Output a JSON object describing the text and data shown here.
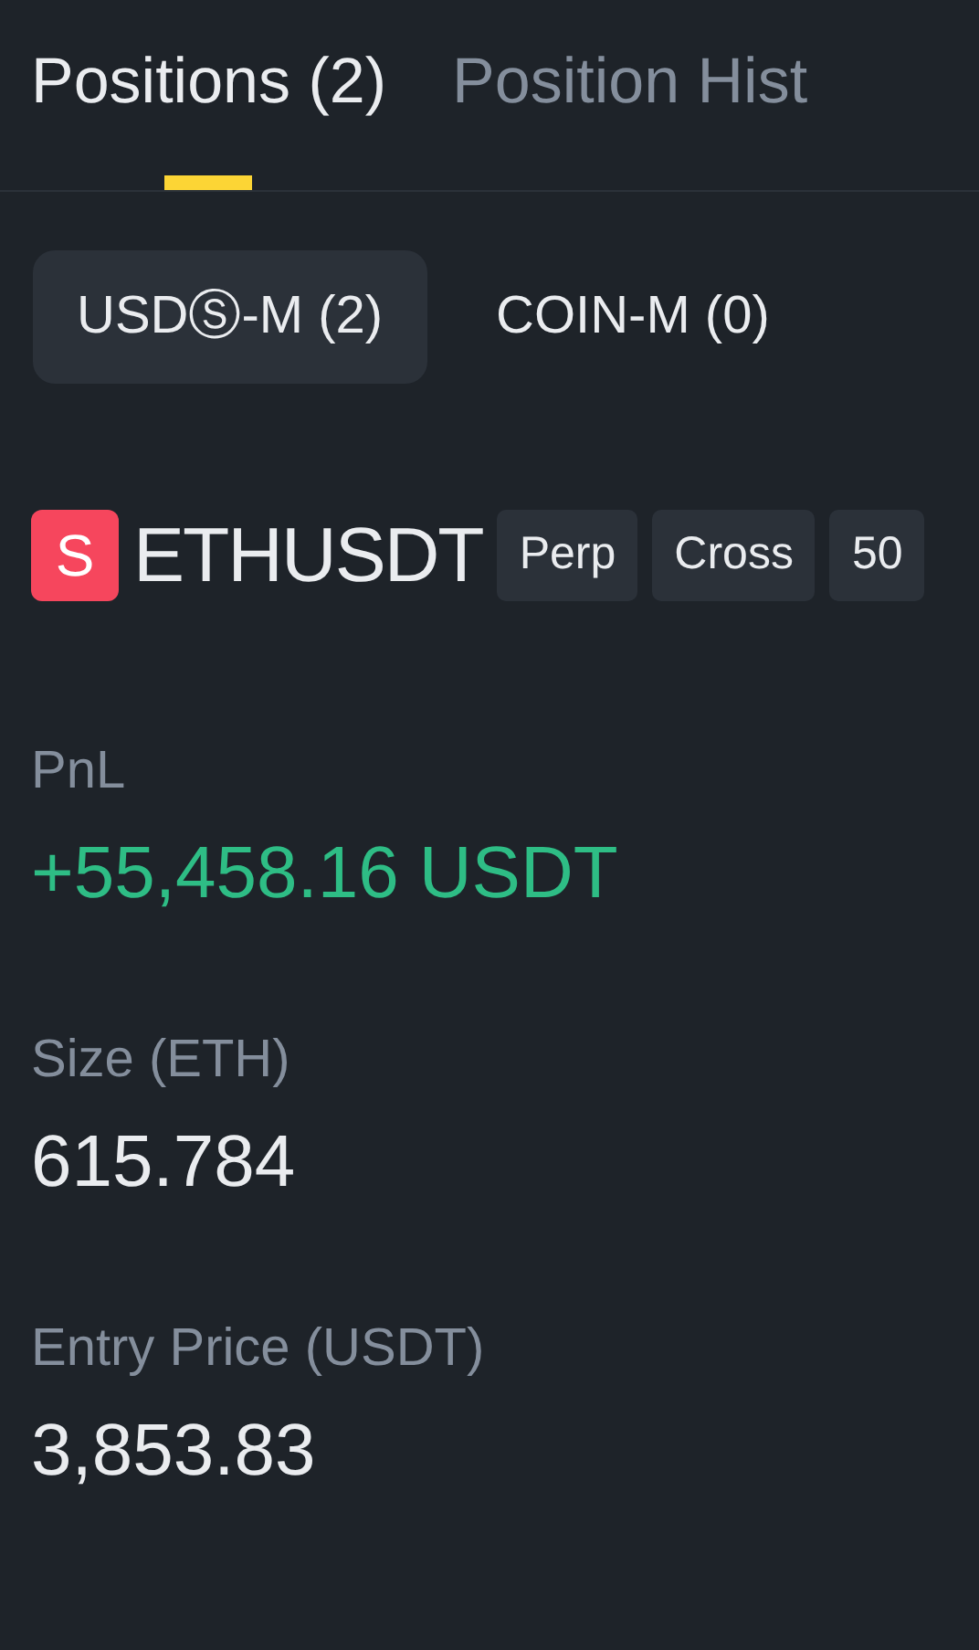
{
  "tabs": [
    {
      "label": "Positions (2)",
      "selected": true
    },
    {
      "label": "Position Hist",
      "selected": false
    }
  ],
  "segments": [
    {
      "label": "USDⓈ-M (2)",
      "selected": true
    },
    {
      "label": "COIN-M (0)",
      "selected": false
    }
  ],
  "position": {
    "side": {
      "label": "S",
      "kind": "sell"
    },
    "symbol": "ETHUSDT",
    "tags": [
      "Perp",
      "Cross",
      "50"
    ]
  },
  "fields": [
    {
      "label": "PnL",
      "value": "+55,458.16 USDT",
      "kind": "profit"
    },
    {
      "label": "Size (ETH)",
      "value": "615.784",
      "kind": "plain"
    },
    {
      "label": "Entry Price (USDT)",
      "value": "3,853.83",
      "kind": "plain"
    }
  ]
}
